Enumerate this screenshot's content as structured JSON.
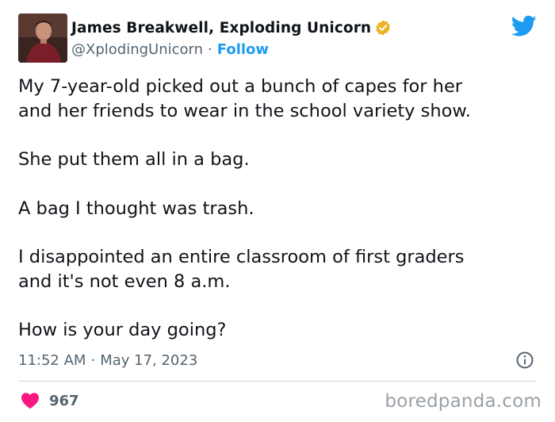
{
  "author": {
    "display_name": "James Breakwell, Exploding Unicorn",
    "handle": "@XplodingUnicorn",
    "separator": "·",
    "follow_label": "Follow"
  },
  "tweet": {
    "paragraphs": [
      [
        "My 7-year-old picked out a bunch of capes for her",
        "and her friends to wear in the school variety show."
      ],
      [
        "She put them all in a bag."
      ],
      [
        "A bag I thought was trash."
      ],
      [
        "I disappointed an entire classroom of first graders",
        "and it's not even 8 a.m."
      ],
      [
        "How is your day going?"
      ]
    ]
  },
  "meta": {
    "time": "11:52 AM",
    "separator": "·",
    "date": "May 17, 2023"
  },
  "engagement": {
    "likes": "967"
  },
  "watermark": "boredpanda.com",
  "icons": {
    "verified": "verified-badge-icon",
    "brand": "twitter-bird-icon",
    "info": "info-icon",
    "like": "heart-icon"
  },
  "colors": {
    "accent": "#1d9bf0",
    "text": "#0f1419",
    "muted": "#536471",
    "like": "#f91880",
    "verified": "#e8b423",
    "divider": "#cfd9de"
  }
}
